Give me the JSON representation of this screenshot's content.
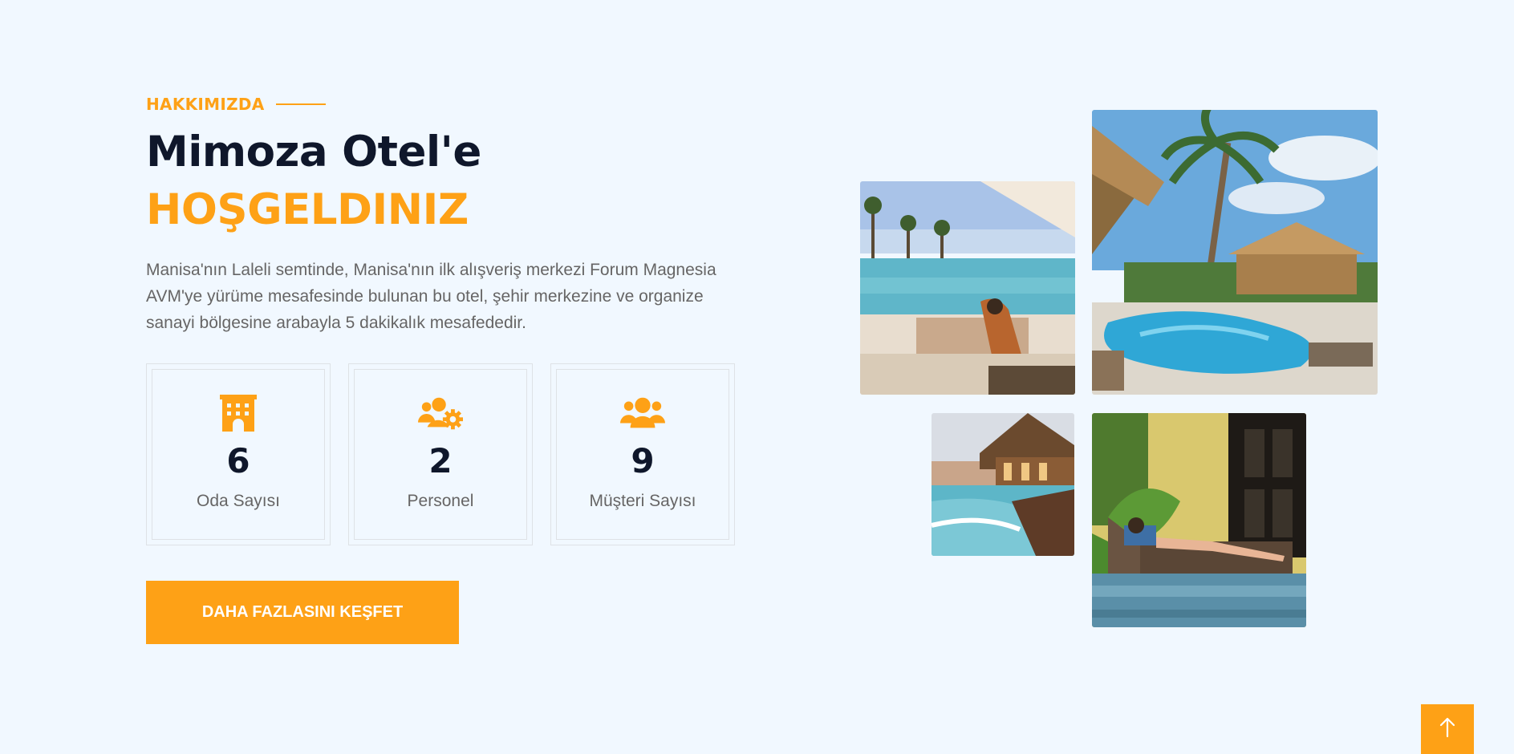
{
  "about": {
    "section_label": "HAKKIMIZDA",
    "title_line1": "Mimoza Otel'e",
    "title_line2": "HOŞGELDINIZ",
    "description": "Manisa'nın Laleli semtinde, Manisa'nın ilk alışveriş merkezi Forum Magnesia AVM'ye yürüme mesafesinde bulunan bu otel, şehir merkezine ve organize sanayi bölgesine arabayla 5 dakikalık mesafededir.",
    "cta_label": "DAHA FAZLASINI KEŞFET"
  },
  "stats": [
    {
      "icon": "hotel-icon",
      "value": "6",
      "label": "Oda Sayısı"
    },
    {
      "icon": "users-cog-icon",
      "value": "2",
      "label": "Personel"
    },
    {
      "icon": "users-icon",
      "value": "9",
      "label": "Müşteri Sayısı"
    }
  ],
  "gallery": [
    {
      "name": "pool-lounge-photo"
    },
    {
      "name": "resort-pool-palms-photo"
    },
    {
      "name": "poolside-restaurant-photo"
    },
    {
      "name": "sunbather-poolside-photo"
    }
  ],
  "colors": {
    "accent": "#fea116",
    "dark": "#0f172b",
    "text": "#666565",
    "background": "#f1f8ff"
  },
  "scroll_top": {
    "icon": "arrow-up-icon"
  }
}
